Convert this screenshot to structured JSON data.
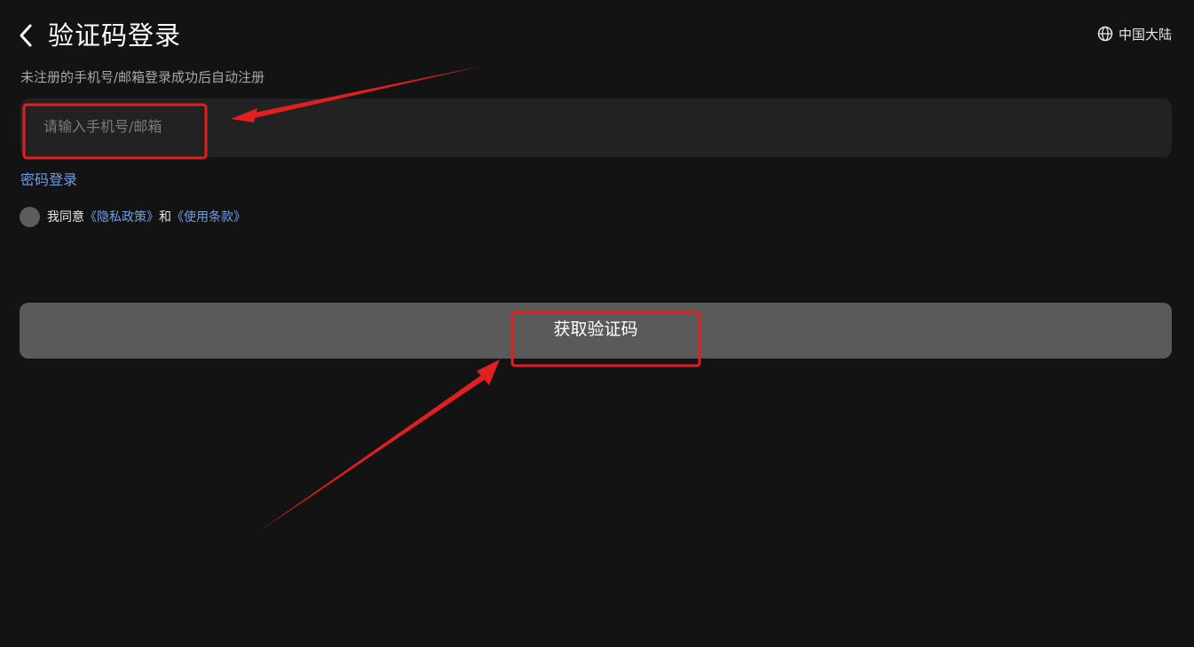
{
  "header": {
    "back_icon": "chevron-left-icon",
    "title": "验证码登录",
    "region_icon": "globe-icon",
    "region_label": "中国大陆"
  },
  "subtitle": "未注册的手机号/邮箱登录成功后自动注册",
  "account_input": {
    "value": "",
    "placeholder": "请输入手机号/邮箱"
  },
  "password_login_label": "密码登录",
  "agreement": {
    "checked": false,
    "prefix": "我同意",
    "privacy_link": "《隐私政策》",
    "conjunction": "和",
    "terms_link": "《使用条款》"
  },
  "get_code_label": "获取验证码",
  "colors": {
    "background": "#131313",
    "input_background": "#222222",
    "button_background": "#5a5a5a",
    "link": "#6f9ee9",
    "annotation": "#e02020"
  }
}
